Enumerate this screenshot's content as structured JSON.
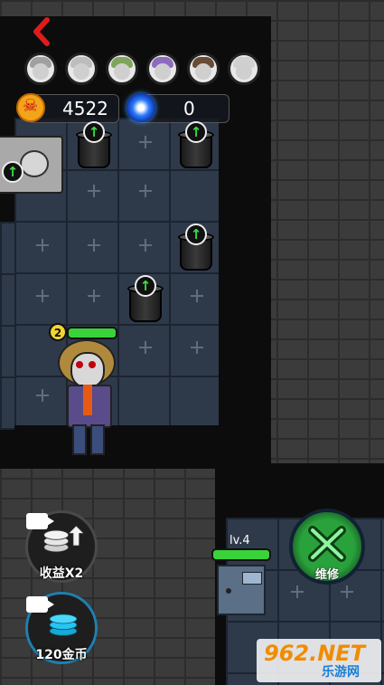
{
  "resources": {
    "coins": "4522",
    "gems": "0"
  },
  "party": [
    {
      "name": "ghost-girl",
      "hair": "#a0a0a0"
    },
    {
      "name": "old-man",
      "hair": "#bdbdbd"
    },
    {
      "name": "green-hair",
      "hair": "#7fa45c"
    },
    {
      "name": "purple-hair",
      "hair": "#8d6bbf"
    },
    {
      "name": "brown-hair",
      "hair": "#6a4b33"
    },
    {
      "name": "bald-old",
      "hair": "#d0d0d0"
    }
  ],
  "monster": {
    "level": "2",
    "health_fraction": 1.0
  },
  "door": {
    "level_label": "lv.4",
    "health_fraction": 1.0
  },
  "buttons": {
    "income_x2": "收益X2",
    "gold_120": "120金币",
    "repair": "维修"
  },
  "watermark": {
    "number": "962.NET",
    "site": "乐游网"
  },
  "colors": {
    "accent_red": "#e01b1b",
    "health_green": "#39d339",
    "coin": "#f3a41b",
    "repair": "#2aa23c"
  }
}
